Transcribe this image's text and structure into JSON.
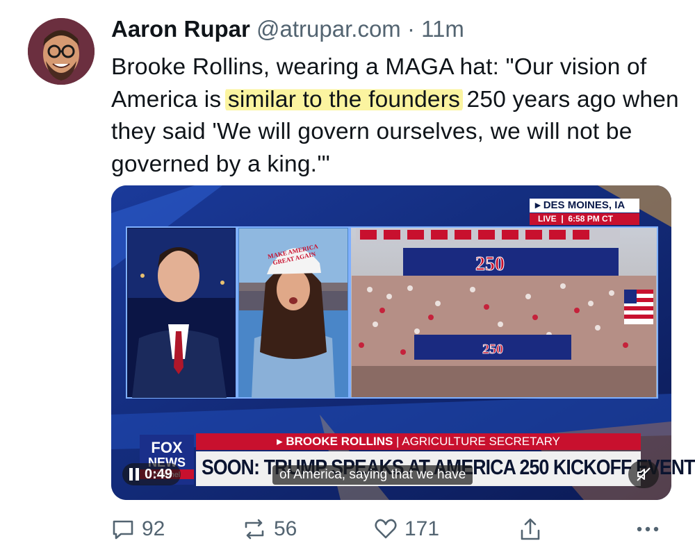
{
  "author": {
    "name": "Aaron Rupar",
    "handle": "@atrupar.com",
    "separator": "·",
    "time": "11m"
  },
  "tweet": {
    "text_before": "Brooke Rollins, wearing a MAGA hat: \"Our vision of America is ",
    "text_highlight": "similar to the founders",
    "text_after": " 250 years ago when they said 'We will govern ourselves, we will not be governed by a king.'\""
  },
  "video": {
    "location": "DES MOINES, IA",
    "live_label": "LIVE",
    "live_time": "6:58 PM CT",
    "hat_text_line1": "MAKE AMERICA",
    "hat_text_line2": "GREAT AGAIN",
    "stage_banner": "250",
    "lower_third_name": "BROOKE ROLLINS",
    "lower_third_title": "AGRICULTURE SECRETARY",
    "ticker": "SOON: TRUMP SPEAKS AT AMERICA 250 KICKOFF EVENT",
    "network_logo_line1": "FOX",
    "network_logo_line2": "NEWS",
    "network_logo_line3": "channel",
    "caption": "of America, saying that we have",
    "timecode": "0:49"
  },
  "actions": {
    "reply_count": "92",
    "repost_count": "56",
    "like_count": "171"
  },
  "icons": {
    "reply": "reply-icon",
    "repost": "repost-icon",
    "like": "heart-icon",
    "share": "share-icon",
    "more": "more-icon",
    "pause": "pause-icon",
    "mute": "muted-speaker-icon"
  },
  "colors": {
    "muted_text": "#536471",
    "highlight": "#fbf4a0",
    "fox_red": "#c8102e"
  }
}
